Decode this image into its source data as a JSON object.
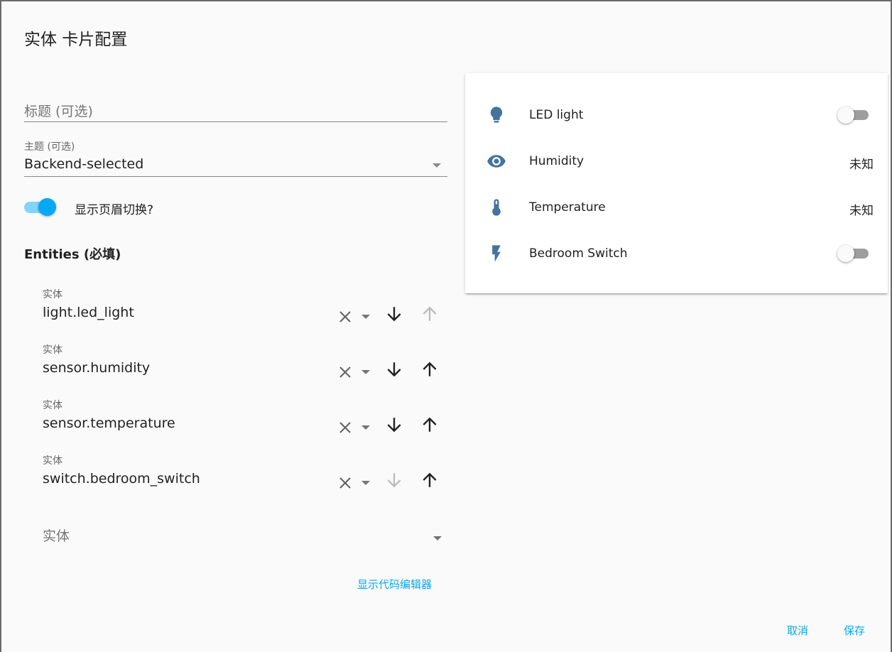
{
  "dialog": {
    "title": "实体 卡片配置"
  },
  "editor": {
    "title_field": {
      "placeholder": "标题 (可选)"
    },
    "theme_field": {
      "label": "主题 (可选)",
      "value": "Backend-selected"
    },
    "header_toggle": {
      "label": "显示页眉切换?",
      "checked": true
    },
    "entities_heading": "Entities (必填)",
    "entities": [
      {
        "label": "实体",
        "value": "light.led_light",
        "down_enabled": true,
        "up_enabled": false
      },
      {
        "label": "实体",
        "value": "sensor.humidity",
        "down_enabled": true,
        "up_enabled": true
      },
      {
        "label": "实体",
        "value": "sensor.temperature",
        "down_enabled": true,
        "up_enabled": true
      },
      {
        "label": "实体",
        "value": "switch.bedroom_switch",
        "down_enabled": false,
        "up_enabled": true
      }
    ],
    "new_entity": {
      "placeholder": "实体"
    },
    "code_editor_link": "显示代码编辑器"
  },
  "preview": {
    "rows": [
      {
        "icon": "lightbulb-icon",
        "name": "LED light",
        "control": "toggle",
        "state": "off"
      },
      {
        "icon": "eye-icon",
        "name": "Humidity",
        "control": "text",
        "state": "未知"
      },
      {
        "icon": "thermometer-icon",
        "name": "Temperature",
        "control": "text",
        "state": "未知"
      },
      {
        "icon": "flash-icon",
        "name": "Bedroom Switch",
        "control": "toggle",
        "state": "off"
      }
    ]
  },
  "footer": {
    "cancel_label": "取消",
    "save_label": "保存"
  },
  "colors": {
    "accent": "#03a9f4",
    "icon": "#44739e",
    "toggle_off": "#9e9e9e"
  }
}
